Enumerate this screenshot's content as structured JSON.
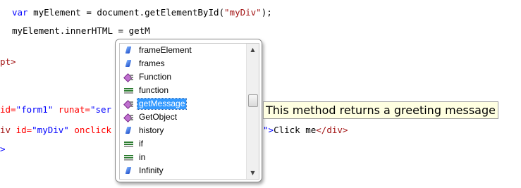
{
  "code": {
    "line1": {
      "kw": "var",
      "rest_a": " myElement = document.getElementById(",
      "str": "\"myDiv\"",
      "rest_b": ");"
    },
    "line2": "myElement.innerHTML = getM",
    "line3_tail": "pt>",
    "line4": {
      "attr_head": "id=",
      "val": "\"form1\"",
      "attr2": " runat=",
      "val2_partial": "\"ser"
    },
    "line5": {
      "head": "iv ",
      "attr": "id=",
      "val": "\"myDiv\"",
      "attr2": " onclick",
      "val_tail": "\"",
      "bracket": ">",
      "text": "Click me",
      "close": "</div>"
    },
    "line6": ">"
  },
  "intellisense": {
    "items": [
      {
        "label": "frameElement",
        "icon": "property-icon"
      },
      {
        "label": "frames",
        "icon": "property-icon"
      },
      {
        "label": "Function",
        "icon": "method-icon"
      },
      {
        "label": "function",
        "icon": "keyword-icon"
      },
      {
        "label": "getMessage",
        "icon": "method-icon",
        "selected": true
      },
      {
        "label": "GetObject",
        "icon": "method-icon"
      },
      {
        "label": "history",
        "icon": "property-icon"
      },
      {
        "label": "if",
        "icon": "keyword-icon"
      },
      {
        "label": "in",
        "icon": "keyword-icon"
      },
      {
        "label": "Infinity",
        "icon": "property-icon"
      }
    ],
    "scroll_up_glyph": "▲",
    "scroll_down_glyph": "▼"
  },
  "tooltip": {
    "text": "This method returns a greeting message"
  }
}
